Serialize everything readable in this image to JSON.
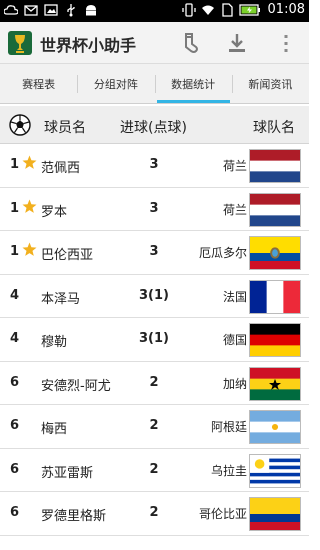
{
  "status_bar": {
    "time": "01:08",
    "icons": [
      "cloud-icon",
      "mail-icon",
      "image-icon",
      "usb-icon",
      "android-icon",
      "vibrate-icon",
      "wifi-icon",
      "sim-icon",
      "battery-charging-icon"
    ]
  },
  "app": {
    "title": "世界杯小助手",
    "icon": "world-cup-trophy-icon",
    "actions": [
      "sock-icon",
      "download-icon",
      "overflow-menu-icon"
    ]
  },
  "tabs": [
    {
      "label": "赛程表",
      "active": false
    },
    {
      "label": "分组对阵",
      "active": false
    },
    {
      "label": "数据统计",
      "active": true
    },
    {
      "label": "新闻资讯",
      "active": false
    }
  ],
  "table": {
    "header": {
      "icon": "soccer-ball-icon",
      "player": "球员名",
      "goals": "进球(点球)",
      "team": "球队名"
    },
    "rows": [
      {
        "rank": "1",
        "star": true,
        "player": "范佩西",
        "goals": "3",
        "team": "荷兰",
        "flag": "netherlands"
      },
      {
        "rank": "1",
        "star": true,
        "player": "罗本",
        "goals": "3",
        "team": "荷兰",
        "flag": "netherlands"
      },
      {
        "rank": "1",
        "star": true,
        "player": "巴伦西亚",
        "goals": "3",
        "team": "厄瓜多尔",
        "flag": "ecuador"
      },
      {
        "rank": "4",
        "star": false,
        "player": "本泽马",
        "goals": "3(1)",
        "team": "法国",
        "flag": "france"
      },
      {
        "rank": "4",
        "star": false,
        "player": "穆勒",
        "goals": "3(1)",
        "team": "德国",
        "flag": "germany"
      },
      {
        "rank": "6",
        "star": false,
        "player": "安德烈-阿尤",
        "goals": "2",
        "team": "加纳",
        "flag": "ghana"
      },
      {
        "rank": "6",
        "star": false,
        "player": "梅西",
        "goals": "2",
        "team": "阿根廷",
        "flag": "argentina"
      },
      {
        "rank": "6",
        "star": false,
        "player": "苏亚雷斯",
        "goals": "2",
        "team": "乌拉圭",
        "flag": "uruguay"
      },
      {
        "rank": "6",
        "star": false,
        "player": "罗德里格斯",
        "goals": "2",
        "team": "哥伦比亚",
        "flag": "colombia"
      }
    ]
  },
  "colors": {
    "tab_indicator": "#33b5e5",
    "star": "#f2b01e"
  }
}
